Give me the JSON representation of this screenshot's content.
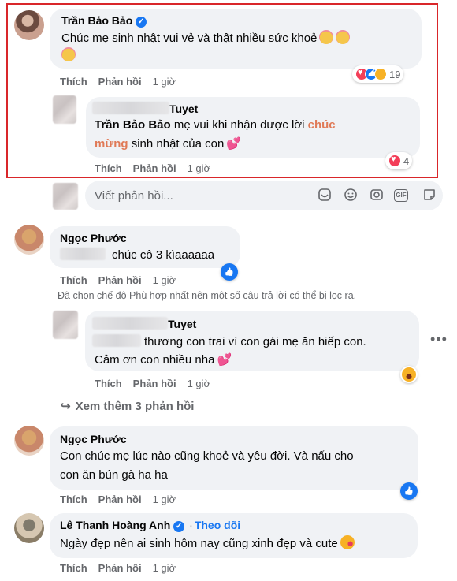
{
  "actions": {
    "like": "Thích",
    "reply": "Phản hồi"
  },
  "comment1": {
    "author": "Trần Bảo Bảo",
    "text_line1": "Chúc mẹ sinh nhật vui vẻ và thật nhiều sức khoẻ",
    "time": "1 giờ",
    "reaction_count": "19"
  },
  "reply1": {
    "author": "Tuyet",
    "mention": "Trần Bảo Bảo",
    "text_a": " mẹ vui khi nhận được lời ",
    "highlight_a": "chúc",
    "highlight_b": "mừng",
    "text_b": " sinh nhật của con",
    "time": "1 giờ",
    "reaction_count": "4"
  },
  "reply_input": {
    "placeholder": "Viết phản hồi..."
  },
  "comment2": {
    "author": "Ngọc Phước",
    "text": "chúc cô 3 kìaaaaaa",
    "time": "1 giờ"
  },
  "filter_note": "Đã chọn chế độ Phù hợp nhất nên một số câu trả lời có thể bị lọc ra.",
  "reply2": {
    "author": "Tuyet",
    "text_line1": "thương con trai vì con gái mẹ ăn hiếp con.",
    "text_line2": "Cảm ơn con nhiều nha",
    "time": "1 giờ"
  },
  "see_more": "Xem thêm 3 phản hồi",
  "comment3": {
    "author": "Ngọc Phước",
    "text_line1": "Con chúc mẹ lúc nào cũng khoẻ và yêu đời. Và nấu cho",
    "text_line2": "con ăn bún gà ha ha",
    "time": "1 giờ"
  },
  "comment4": {
    "author": "Lê Thanh Hoàng Anh",
    "follow": "Theo dõi",
    "separator": "·",
    "text": "Ngày đẹp nên ai sinh hôm nay cũng xinh đẹp và cute",
    "time": "1 giờ"
  },
  "colors": {
    "highlight_border": "#d9262a",
    "link_blue": "#1877f2",
    "orange_text": "#e07a57",
    "bubble_bg": "#f0f2f5",
    "muted": "#65676b"
  },
  "icons": [
    "verified-badge-icon",
    "heart-reaction-icon",
    "like-reaction-icon",
    "care-reaction-icon",
    "sticker-icon",
    "emoji-icon",
    "camera-icon",
    "gif-icon",
    "avatar-sticker-icon",
    "reply-arrow-icon",
    "more-options-icon",
    "haha-reaction-icon"
  ]
}
